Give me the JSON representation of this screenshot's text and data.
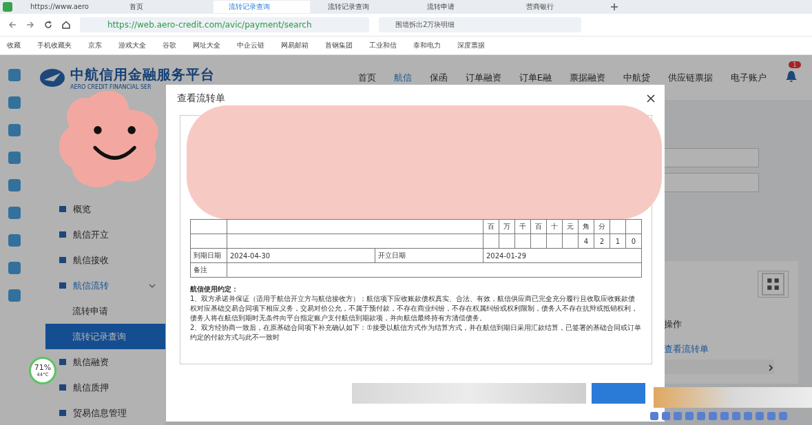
{
  "browser": {
    "tabs": [
      {
        "label": "https://www.aero",
        "selected": false
      },
      {
        "label": "首页",
        "selected": false
      },
      {
        "label": "流转记录查询",
        "selected": true
      },
      {
        "label": "流转记录查询",
        "selected": false
      },
      {
        "label": "流转申请",
        "selected": false
      },
      {
        "label": "营商银行",
        "selected": false
      }
    ],
    "address": "https://web.aero-credit.com/avic/payment/search",
    "search": "围墙拆出2万块明细",
    "bookmarks": [
      "收藏",
      "手机收藏夹",
      "京东",
      "游戏大全",
      "谷歌",
      "网址大全",
      "中企云链",
      "网易邮箱",
      "首钢集团",
      "工业和信",
      "泰和电力",
      "深度票据"
    ]
  },
  "app": {
    "logo_title": "中航信用金融服务平台",
    "logo_subtitle": "AERO CREDIT FINANCIAL SER",
    "nav": [
      {
        "label": "首页",
        "selected": false
      },
      {
        "label": "航信",
        "selected": true
      },
      {
        "label": "保函",
        "selected": false
      },
      {
        "label": "订单融资",
        "selected": false
      },
      {
        "label": "订单E融",
        "selected": false
      },
      {
        "label": "票据融资",
        "selected": false
      },
      {
        "label": "中航贷",
        "selected": false
      },
      {
        "label": "供应链票据",
        "selected": false
      },
      {
        "label": "电子账户",
        "selected": false
      }
    ],
    "notification_count": "1"
  },
  "sidebar": {
    "items": [
      {
        "label": "概览",
        "selected": false
      },
      {
        "label": "航信开立",
        "selected": false
      },
      {
        "label": "航信接收",
        "selected": false
      },
      {
        "label": "航信流转",
        "selected": true,
        "expanded": true,
        "children": [
          {
            "label": "流转申请",
            "selected": false
          },
          {
            "label": "流转记录查询",
            "selected": true
          }
        ]
      },
      {
        "label": "航信融资",
        "selected": false
      },
      {
        "label": "航信质押",
        "selected": false
      },
      {
        "label": "贸易信息管理",
        "selected": false
      }
    ]
  },
  "content": {
    "column_header": "操作",
    "action_link": "查看流转单"
  },
  "widget": {
    "percent": "71%",
    "temperature": "44°C"
  },
  "modal": {
    "title": "查看流转单",
    "amount_columns": [
      {
        "header": "百"
      },
      {
        "header": "万"
      },
      {
        "header": "千"
      },
      {
        "header": "百"
      },
      {
        "header": "十"
      },
      {
        "header": "元"
      },
      {
        "header": "角",
        "digit": "4"
      },
      {
        "header": "分",
        "digit": "2"
      },
      {
        "digit": "1"
      },
      {
        "digit": "0"
      }
    ],
    "rows": [
      {
        "label": "到期日期",
        "value": "2024-04-30",
        "label_2": "开立日期",
        "value_2": "2024-01-29"
      },
      {
        "label": "备注"
      }
    ],
    "terms_title": "航信使用约定：",
    "terms": [
      "1、双方承诺并保证（适用于航信开立方与航信接收方）：航信项下应收账款债权真实、合法、有效，航信供应商已完全充分履行且收取应收账款债权对应基础交易合同项下相应义务，交易对价公允，不属于预付款，不存在商业纠纷，不存在权属纠纷或权利限制，债务人不存在抗辩或抵销权利，债务人将在航信到期时无条件向平台指定账户支付航信到期款项，并向航信最终持有方清偿债务。",
      "2、双方经协商一致后，在原基础合同项下补充确认如下：①接受以航信方式作为结算方式，并在航信到期日采用汇款结算，已签署的基础合同或订单约定的付款方式与此不一致时"
    ]
  }
}
